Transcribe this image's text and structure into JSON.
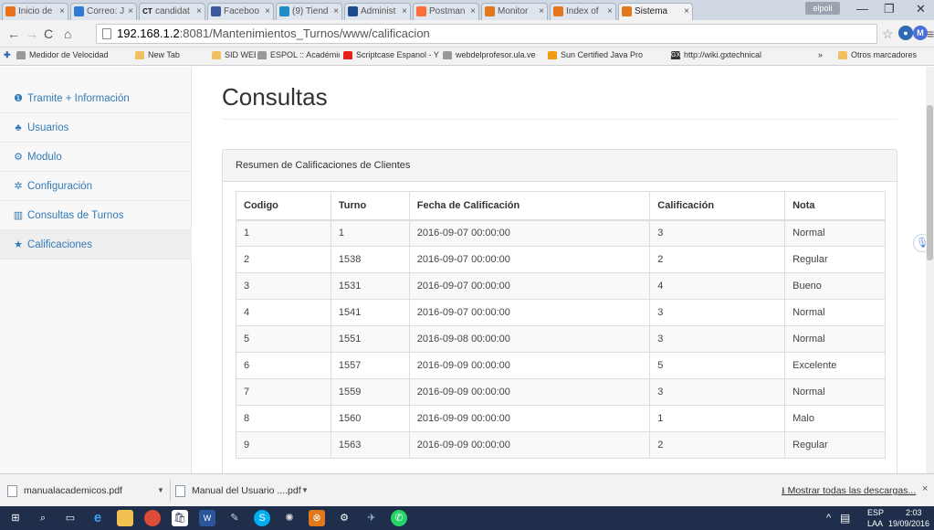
{
  "browser": {
    "tabs": [
      {
        "title": "Inicio de",
        "icon": "orange-square-icon",
        "color": "#e8711a"
      },
      {
        "title": "Correo: J",
        "icon": "mail-icon",
        "color": "#2f7bd1"
      },
      {
        "title": "candidat",
        "icon": "ct-logo-icon",
        "color": "#111111",
        "prefix": "CT"
      },
      {
        "title": "Faceboo",
        "icon": "facebook-icon",
        "color": "#3b5998"
      },
      {
        "title": "(9) Tiend",
        "icon": "circle-icon",
        "color": "#1f8cc6"
      },
      {
        "title": "Administ",
        "icon": "star-icon",
        "color": "#1c4c8c"
      },
      {
        "title": "Postman",
        "icon": "postman-icon",
        "color": "#ff6c37"
      },
      {
        "title": "Monitor",
        "icon": "xampp-icon",
        "color": "#e3771b"
      },
      {
        "title": "Index of",
        "icon": "xampp-icon",
        "color": "#e3771b"
      },
      {
        "title": "Sistema",
        "icon": "xampp-icon",
        "color": "#e3771b"
      }
    ],
    "profile": "elpoli",
    "url_host": "192.168.1.2",
    "url_path": ":8081/Mantenimientos_Turnos/www/calificacion",
    "bookmarks": [
      {
        "label": "Medidor de Velocidad",
        "color": "#999999"
      },
      {
        "label": "",
        "color": "#999999"
      },
      {
        "label": "New Tab",
        "color": "#f0c060"
      },
      {
        "label": "SID WEB",
        "color": "#f0c060"
      },
      {
        "label": "ESPOL :: Académico e",
        "color": "#999999"
      },
      {
        "label": "Scriptcase Espanol - Y",
        "color": "#e62117"
      },
      {
        "label": "webdelprofesor.ula.ve",
        "color": "#999999"
      },
      {
        "label": "Sun Certified Java Pro",
        "color": "#f39c12"
      },
      {
        "label": "http://wiki.gxtechnical",
        "color": "#333333",
        "prefix": "GX"
      }
    ],
    "bookmarks_overflow": "»",
    "other_bookmarks": "Otros marcadores"
  },
  "sidebar": {
    "items": [
      {
        "label": "Tramite + Información",
        "icon": "info-icon",
        "glyph": "❶"
      },
      {
        "label": "Usuarios",
        "icon": "users-icon",
        "glyph": "♣"
      },
      {
        "label": "Modulo",
        "icon": "cubes-icon",
        "glyph": "⚙"
      },
      {
        "label": "Configuración",
        "icon": "gear-icon",
        "glyph": "✲"
      },
      {
        "label": "Consultas de Turnos",
        "icon": "bar-chart-icon",
        "glyph": "▥"
      },
      {
        "label": "Calificaciones",
        "icon": "star-icon",
        "glyph": "★"
      }
    ]
  },
  "main": {
    "title": "Consultas",
    "panel_heading": "Resumen de Calificaciones de Clientes",
    "columns": [
      "Codigo",
      "Turno",
      "Fecha de Calificación",
      "Calificación",
      "Nota"
    ],
    "rows": [
      [
        "1",
        "1",
        "2016-09-07 00:00:00",
        "3",
        "Normal"
      ],
      [
        "2",
        "1538",
        "2016-09-07 00:00:00",
        "2",
        "Regular"
      ],
      [
        "3",
        "1531",
        "2016-09-07 00:00:00",
        "4",
        "Bueno"
      ],
      [
        "4",
        "1541",
        "2016-09-07 00:00:00",
        "3",
        "Normal"
      ],
      [
        "5",
        "1551",
        "2016-09-08 00:00:00",
        "3",
        "Normal"
      ],
      [
        "6",
        "1557",
        "2016-09-09 00:00:00",
        "5",
        "Excelente"
      ],
      [
        "7",
        "1559",
        "2016-09-09 00:00:00",
        "3",
        "Normal"
      ],
      [
        "8",
        "1560",
        "2016-09-09 00:00:00",
        "1",
        "Malo"
      ],
      [
        "9",
        "1563",
        "2016-09-09 00:00:00",
        "2",
        "Regular"
      ]
    ]
  },
  "downloads": {
    "items": [
      {
        "name": "manualacademicos.pdf"
      },
      {
        "name": "Manual del Usuario ....pdf"
      }
    ],
    "show_all": "Mostrar todas las descargas...",
    "close": "×"
  },
  "taskbar": {
    "lang_top": "ESP",
    "lang_bottom": "LAA",
    "time": "2:03",
    "date": "19/09/2016"
  }
}
